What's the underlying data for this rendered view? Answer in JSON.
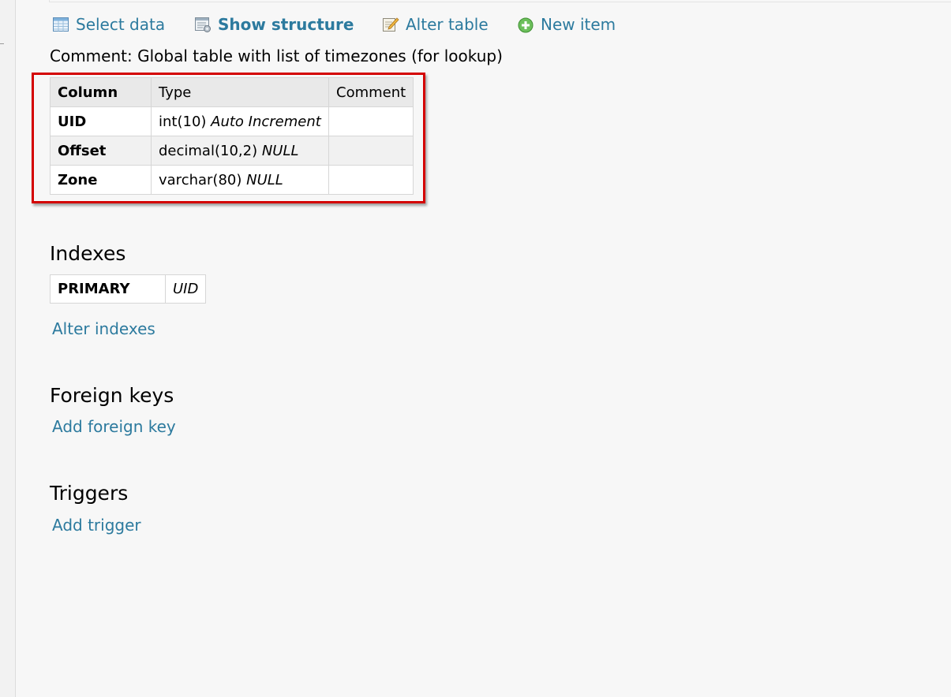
{
  "toolbar": {
    "items": [
      {
        "label": "Select data",
        "icon": "table-icon"
      },
      {
        "label": "Show structure",
        "icon": "structure-icon",
        "active": true
      },
      {
        "label": "Alter table",
        "icon": "edit-icon"
      },
      {
        "label": "New item",
        "icon": "plus-circle-icon"
      }
    ]
  },
  "comment": "Comment: Global table with list of timezones (for lookup)",
  "structure": {
    "headers": [
      "Column",
      "Type",
      "Comment"
    ],
    "rows": [
      {
        "column": "UID",
        "type": "int(10)",
        "type_extra": "Auto Increment",
        "comment": ""
      },
      {
        "column": "Offset",
        "type": "decimal(10,2)",
        "type_extra": "NULL",
        "comment": ""
      },
      {
        "column": "Zone",
        "type": "varchar(80)",
        "type_extra": "NULL",
        "comment": ""
      }
    ]
  },
  "indexes": {
    "title": "Indexes",
    "rows": [
      {
        "type": "PRIMARY",
        "columns": "UID"
      }
    ],
    "alter_link": "Alter indexes"
  },
  "foreign_keys": {
    "title": "Foreign keys",
    "add_link": "Add foreign key"
  },
  "triggers": {
    "title": "Triggers",
    "add_link": "Add trigger"
  },
  "colors": {
    "link": "#2c7a9e",
    "highlight": "#d40000",
    "header_bg": "#e9e9e9"
  }
}
